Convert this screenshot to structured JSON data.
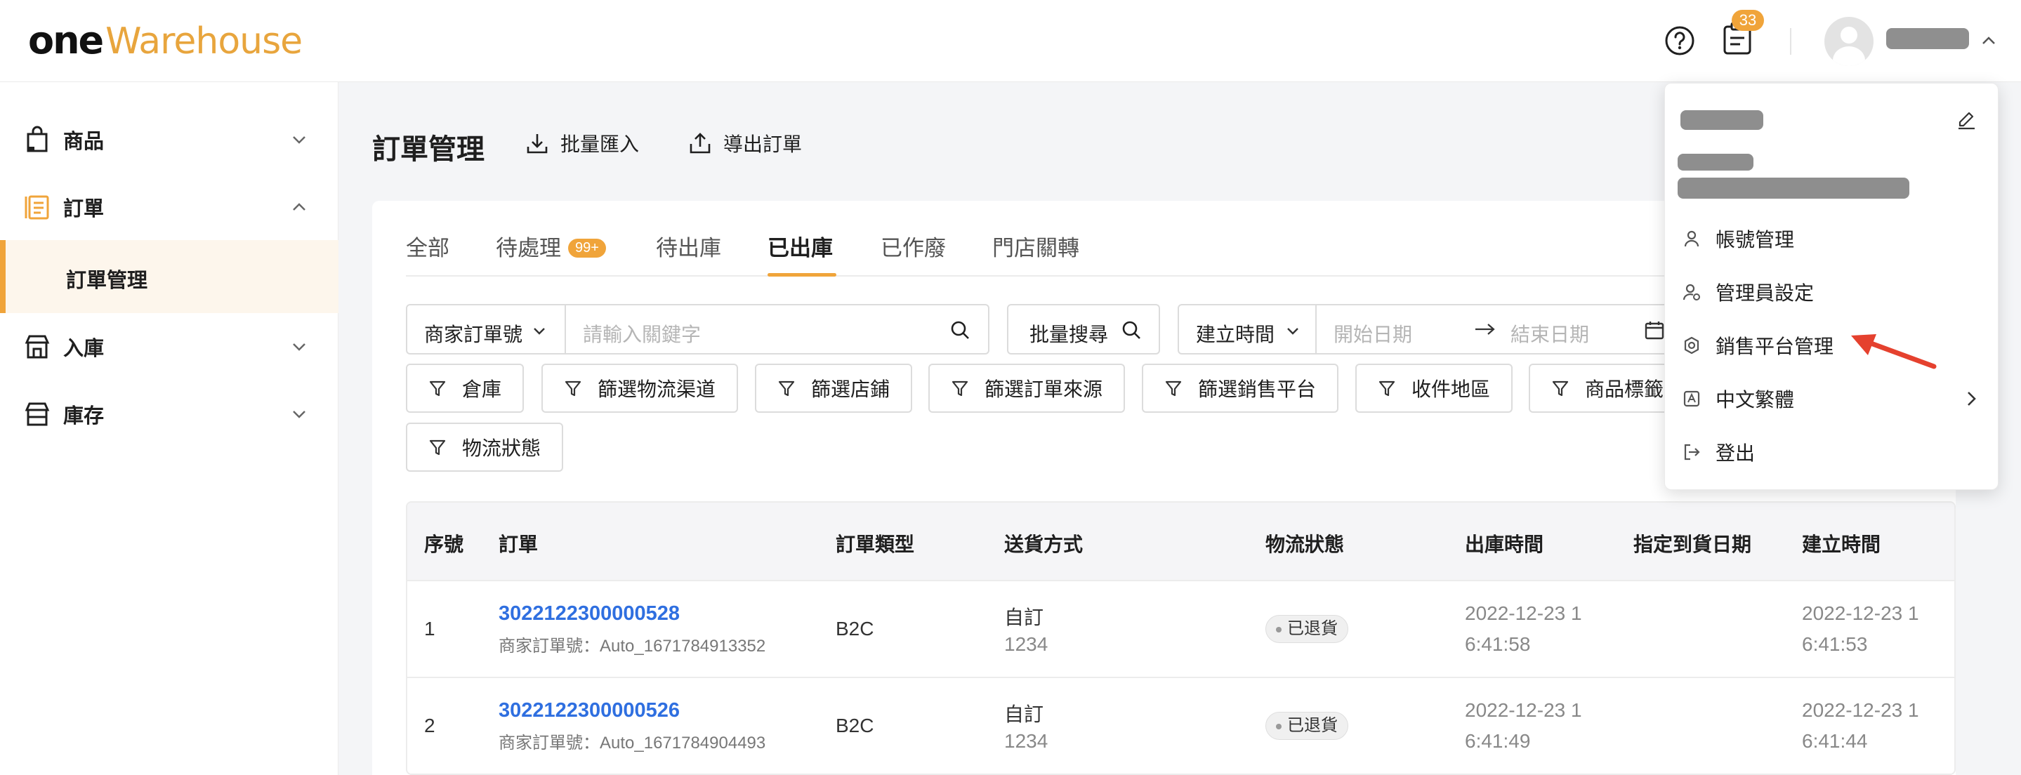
{
  "header": {
    "logo_one": "one",
    "logo_warehouse": "Warehouse",
    "help_icon": "question-circle-icon",
    "notes_icon": "clipboard-icon",
    "notification_count": "33",
    "avatar_icon": "user-avatar-icon",
    "brand_color": "#e8a53d",
    "accent_color": "#f0a43a"
  },
  "sidebar": {
    "items": [
      {
        "label": "商品",
        "icon": "bag-icon"
      },
      {
        "label": "訂單",
        "icon": "order-list-icon",
        "expanded": true
      },
      {
        "label": "入庫",
        "icon": "inbound-store-icon"
      },
      {
        "label": "庫存",
        "icon": "inventory-store-icon"
      }
    ],
    "sub_item": "訂單管理"
  },
  "main": {
    "title": "訂單管理",
    "actions": [
      {
        "label": "批量匯入",
        "icon": "download-icon"
      },
      {
        "label": "導出訂單",
        "icon": "upload-icon"
      }
    ],
    "tabs": [
      {
        "label": "全部"
      },
      {
        "label": "待處理",
        "badge": "99+"
      },
      {
        "label": "待出庫"
      },
      {
        "label": "已出庫",
        "active": true
      },
      {
        "label": "已作廢"
      },
      {
        "label": "門店關轉"
      }
    ],
    "search": {
      "type_select": "商家訂單號",
      "placeholder": "請輸入關鍵字",
      "batch_search": "批量搜尋",
      "time_select": "建立時間",
      "start_placeholder": "開始日期",
      "end_placeholder": "結束日期"
    },
    "filters": [
      "倉庫",
      "篩選物流渠道",
      "篩選店鋪",
      "篩選訂單來源",
      "篩選銷售平台",
      "收件地區",
      "商品標籤",
      "物流狀態"
    ],
    "table": {
      "columns": [
        "序號",
        "訂單",
        "訂單類型",
        "送貨方式",
        "物流狀態",
        "出庫時間",
        "指定到貨日期",
        "建立時間"
      ],
      "rows": [
        {
          "index": "1",
          "order_no": "3022122300000528",
          "merchant_no": "商家訂單號：Auto_1671784913352",
          "type": "B2C",
          "shipping_line1": "自訂",
          "shipping_line2": "1234",
          "status": "已退貨",
          "outbound_line1": "2022-12-23 1",
          "outbound_line2": "6:41:58",
          "created_line1": "2022-12-23 1",
          "created_line2": "6:41:53"
        },
        {
          "index": "2",
          "order_no": "3022122300000526",
          "merchant_no": "商家訂單號：Auto_1671784904493",
          "type": "B2C",
          "shipping_line1": "自訂",
          "shipping_line2": "1234",
          "status": "已退貨",
          "outbound_line1": "2022-12-23 1",
          "outbound_line2": "6:41:49",
          "created_line1": "2022-12-23 1",
          "created_line2": "6:41:44"
        }
      ]
    }
  },
  "user_menu": {
    "edit_icon": "pencil-icon",
    "items": [
      {
        "label": "帳號管理",
        "icon": "user-icon"
      },
      {
        "label": "管理員設定",
        "icon": "admin-user-icon"
      },
      {
        "label": "銷售平台管理",
        "icon": "settings-gear-icon"
      },
      {
        "label": "中文繁體",
        "icon": "language-icon",
        "has_submenu": true
      },
      {
        "label": "登出",
        "icon": "logout-icon"
      }
    ],
    "annotation_color": "#e5412e"
  }
}
